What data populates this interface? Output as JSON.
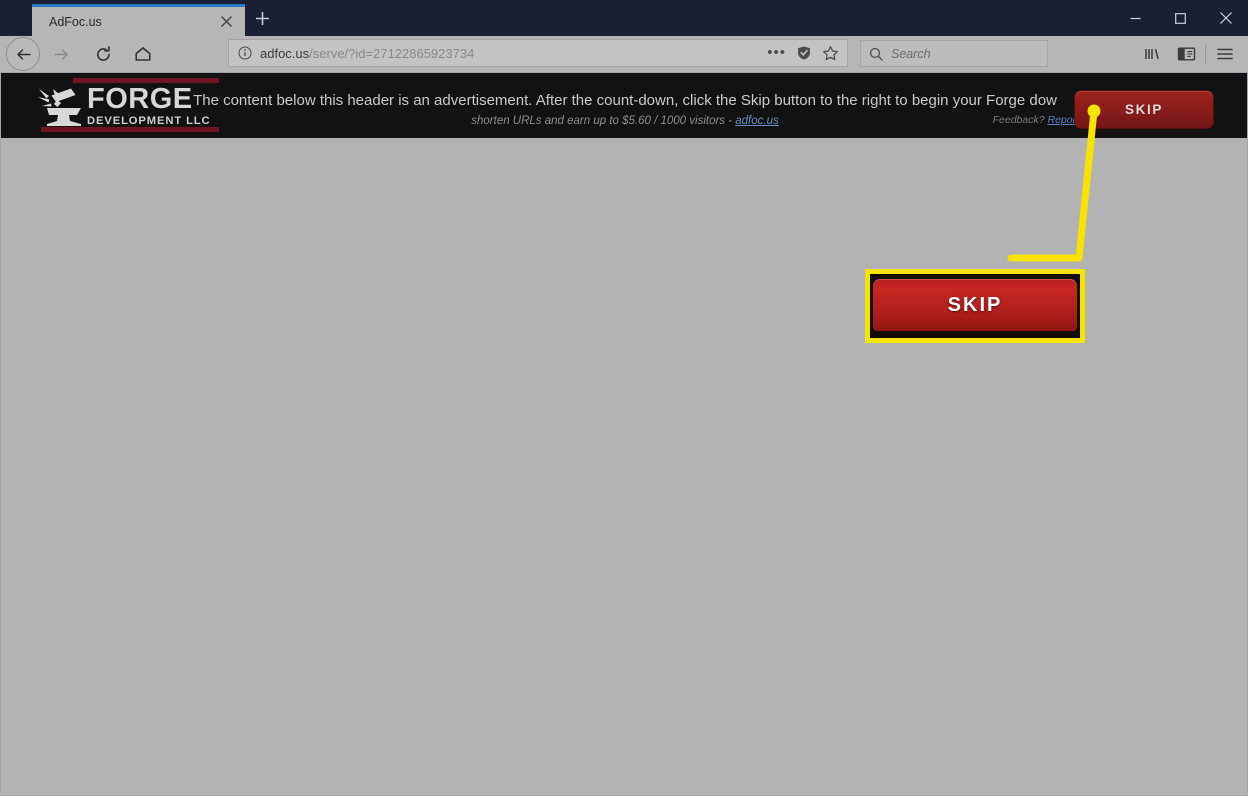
{
  "window": {
    "controls": {
      "minimize": "minimize-button",
      "maximize": "maximize-button",
      "close": "close-button"
    }
  },
  "tabs": {
    "active_tab_title": "AdFoc.us",
    "close_label": "✕",
    "new_tab_label": "+"
  },
  "toolbar": {
    "back": "back-button",
    "forward": "forward-button",
    "reload": "reload-button",
    "home": "home-button",
    "page_actions_label": "•••",
    "library": "library-button",
    "sidebar": "sidebar-button",
    "menu": "menu-button"
  },
  "urlbar": {
    "domain": "adfoc.us",
    "path": "/serve/?id=27122865923734",
    "full": "adfoc.us/serve/?id=27122865923734"
  },
  "search": {
    "placeholder": "Search",
    "value": ""
  },
  "ad_header": {
    "logo": {
      "title": "FORGE",
      "subtitle": "DEVELOPMENT LLC"
    },
    "line1": "The content below this header is an advertisement. After the count-down, click the Skip button to the right to begin your Forge dow",
    "line2_prefix": "shorten URLs and earn up to $5.60 / 1000 visitors - ",
    "line2_link": "adfoc.us",
    "feedback_prefix": "Feedback? ",
    "feedback_link": "Report",
    "skip_label": "SKIP"
  },
  "callout": {
    "skip_label": "SKIP",
    "highlight_color": "#f5e400",
    "button_color": "#c62722"
  },
  "colors": {
    "chrome_dark": "#1b1f33",
    "toolbar_gray": "#b6b6b6",
    "page_gray": "#b3b3b3",
    "ad_header_dark": "#121212",
    "logo_accent_red": "#6d1622",
    "tab_accent_blue": "#2b7cc4"
  }
}
